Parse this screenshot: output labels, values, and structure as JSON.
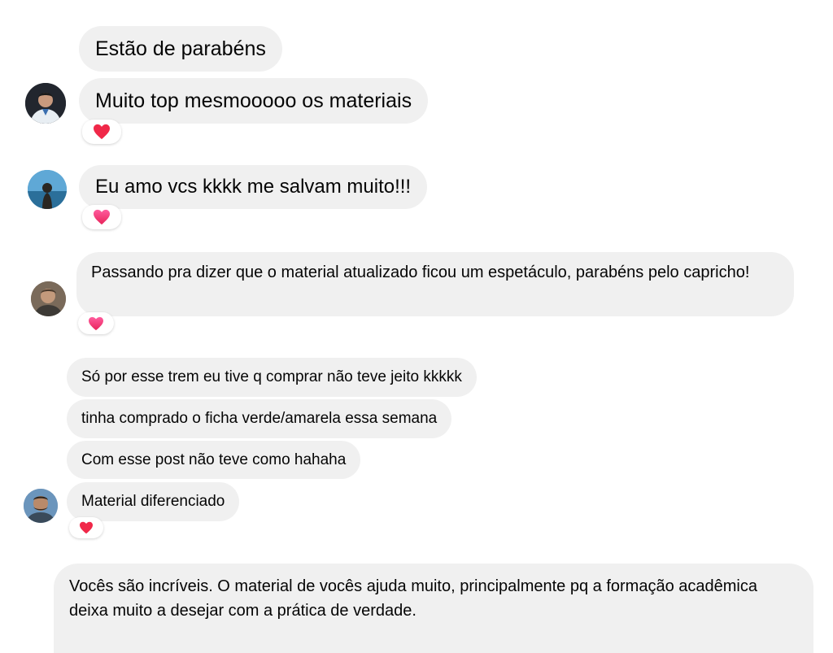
{
  "colors": {
    "bubble_bg": "#f0f0f0",
    "text": "#050505",
    "heart_red": "#f02849",
    "heart_pink": "#ef3e7a"
  },
  "messages": [
    {
      "text": "Estão de parabéns"
    },
    {
      "text": "Muito top mesmooooo os materiais",
      "reaction": "heart-red"
    },
    {
      "text": "Eu amo vcs kkkk me salvam muito!!!",
      "reaction": "heart-pink"
    },
    {
      "text": "Passando pra dizer que o material atualizado ficou um espetáculo, parabéns pelo capricho!",
      "reaction": "heart-pink"
    },
    {
      "text": "Só por esse trem eu tive q comprar não teve jeito kkkkk"
    },
    {
      "text": "tinha comprado o ficha verde/amarela essa semana"
    },
    {
      "text": "Com esse post não teve como hahaha"
    },
    {
      "text": "Material diferenciado",
      "reaction": "heart-red"
    },
    {
      "text": "Vocês são incríveis. O material de vocês ajuda muito, principalmente pq a formação acadêmica deixa muito a desejar com a prática de verdade."
    }
  ],
  "avatars": [
    {
      "name": "avatar-user-1"
    },
    {
      "name": "avatar-user-2"
    },
    {
      "name": "avatar-user-3"
    },
    {
      "name": "avatar-user-4"
    }
  ]
}
